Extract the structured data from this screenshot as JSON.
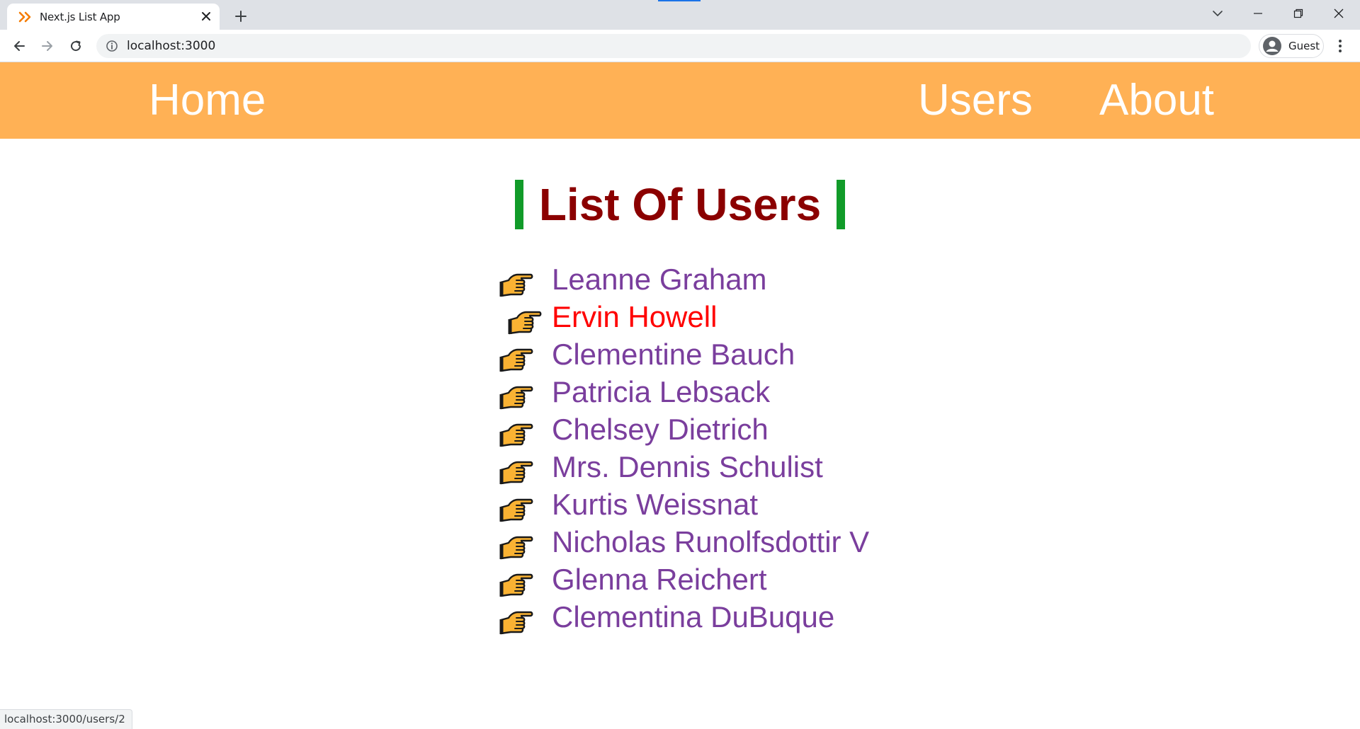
{
  "browser": {
    "tab_title": "Next.js List App",
    "address": "localhost:3000",
    "profile_label": "Guest",
    "status_url": "localhost:3000/users/2"
  },
  "navbar": {
    "home": "Home",
    "users": "Users",
    "about": "About",
    "background_color": "#ffb155"
  },
  "page": {
    "heading": "List Of Users",
    "heading_color": "#8b0000",
    "accent_color": "#119b29"
  },
  "users": [
    {
      "name": "Leanne Graham",
      "hovered": false
    },
    {
      "name": "Ervin Howell",
      "hovered": true
    },
    {
      "name": "Clementine Bauch",
      "hovered": false
    },
    {
      "name": "Patricia Lebsack",
      "hovered": false
    },
    {
      "name": "Chelsey Dietrich",
      "hovered": false
    },
    {
      "name": "Mrs. Dennis Schulist",
      "hovered": false
    },
    {
      "name": "Kurtis Weissnat",
      "hovered": false
    },
    {
      "name": "Nicholas Runolfsdottir V",
      "hovered": false
    },
    {
      "name": "Glenna Reichert",
      "hovered": false
    },
    {
      "name": "Clementina DuBuque",
      "hovered": false
    }
  ],
  "colors": {
    "link": "#7a3e9d",
    "link_hover": "#ff0000"
  },
  "icons": {
    "list_marker": "pointing-hand-icon"
  }
}
